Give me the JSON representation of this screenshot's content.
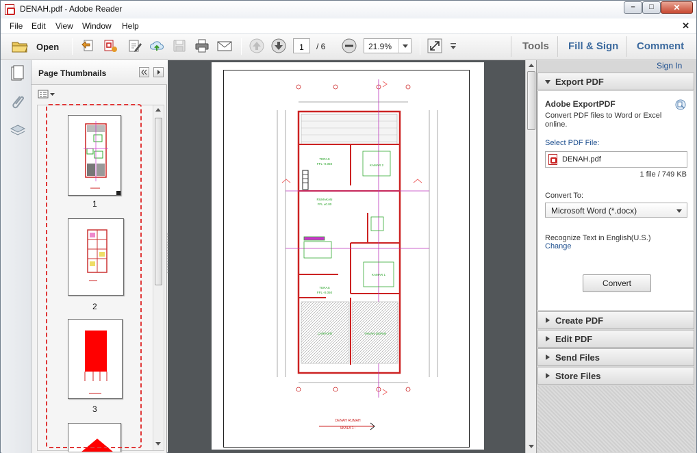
{
  "window": {
    "title": "DENAH.pdf - Adobe Reader",
    "minimize_glyph": "–",
    "maximize_glyph": "□",
    "close_glyph": "✕"
  },
  "menu": {
    "items": [
      "File",
      "Edit",
      "View",
      "Window",
      "Help"
    ],
    "close_document_glyph": "✕"
  },
  "toolbar": {
    "open_label": "Open",
    "current_page": "1",
    "page_total": "/ 6",
    "zoom": "21.9%",
    "tools_label": "Tools",
    "fill_sign_label": "Fill & Sign",
    "comment_label": "Comment"
  },
  "thumbnails": {
    "title": "Page Thumbnails",
    "pages": [
      "1",
      "2",
      "3"
    ]
  },
  "drawing": {
    "footer_title": "DENAH RUMAH",
    "footer_scale": "SKALA 1 :",
    "room_labels": [
      "TERAS",
      "FFL -0.050",
      "KAMAR 2",
      "RUMAKAN",
      "FFL ±0.00",
      "KAMAR 1",
      "TERAS",
      "FFL -0.050",
      "CARPORT",
      "TAMAN DEPAN"
    ]
  },
  "right_pane": {
    "sign_in": "Sign In",
    "export_header": "Export PDF",
    "export_title": "Adobe ExportPDF",
    "export_desc": "Convert PDF files to Word or Excel online.",
    "select_file_label": "Select PDF File:",
    "file_name": "DENAH.pdf",
    "file_info": "1 file / 749 KB",
    "convert_to_label": "Convert To:",
    "convert_to_value": "Microsoft Word (*.docx)",
    "recognize_text": "Recognize Text in English(U.S.)",
    "change_link": "Change",
    "convert_button": "Convert",
    "sections": [
      "Create PDF",
      "Edit PDF",
      "Send Files",
      "Store Files"
    ]
  },
  "colors": {
    "link_blue": "#1c4e8e",
    "highlight_red": "#e03838",
    "doc_bg": "#525659"
  }
}
